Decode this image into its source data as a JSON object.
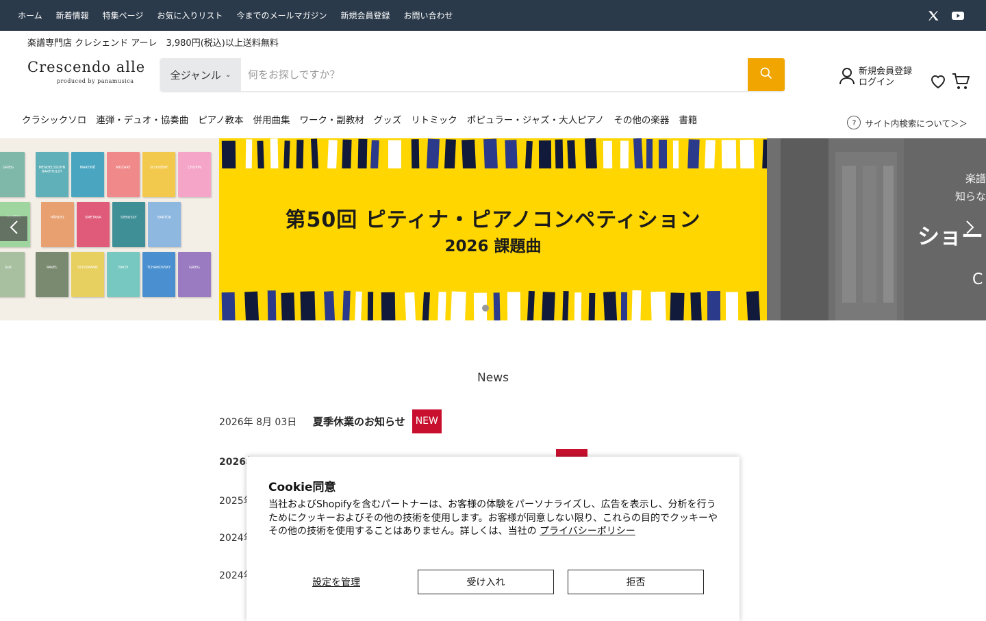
{
  "topbar": {
    "links": [
      "ホーム",
      "新着情報",
      "特集ページ",
      "お気に入りリスト",
      "今までのメールマガジン",
      "新規会員登録",
      "お問い合わせ"
    ],
    "social": [
      "x-icon",
      "youtube-icon"
    ]
  },
  "promo": "楽譜専門店 クレシェンド アーレ　3,980円(税込)以上送料無料",
  "logo": {
    "main": "Crescendo alle",
    "sub": "produced by panamusica"
  },
  "search": {
    "genre": "全ジャンル",
    "placeholder": "何をお探しですか？"
  },
  "account": {
    "register": "新規会員登録",
    "login": "ログイン"
  },
  "categories": [
    "クラシックソロ",
    "連弾・デュオ・協奏曲",
    "ピアノ教本",
    "併用曲集",
    "ワーク・副教材",
    "グッズ",
    "リトミック",
    "ポピュラー・ジャズ・大人ピアノ",
    "その他の楽器",
    "書籍"
  ],
  "site_help": "サイト内検索について＞＞",
  "carousel": {
    "left_books": [
      "GRIEG",
      "MENDELSSOHN BARTHOLDY",
      "MARTINŮ",
      "MOZART",
      "SCHUBERT",
      "CHOPIN",
      "DVOŘÁK",
      "HÄNDEL",
      "SMETANA",
      "DEBUSSY",
      "BARTÓK",
      "SUK",
      "RAVEL",
      "SCHUMANN",
      "BACH",
      "TCHAIKOVSKY"
    ],
    "main_title": "第50回 ピティナ・ピアノコンペティション",
    "main_subtitle": "2026 課題曲",
    "right_line1": "楽譜",
    "right_line2": "知らな",
    "right_title": "ショー",
    "right_letter": "C",
    "colors": {
      "main_bg": "#ffd600",
      "accent": "#f0a500"
    }
  },
  "news": {
    "heading": "News",
    "items": [
      {
        "date": "2026年 8月 03日",
        "title": "夏季休業のお知らせ",
        "badge": "NEW"
      },
      {
        "date": "2026年",
        "title": "",
        "badge": ""
      },
      {
        "date": "2025年",
        "title": "",
        "badge": ""
      },
      {
        "date": "2024年",
        "title": "",
        "badge": ""
      },
      {
        "date": "2024年",
        "title": "",
        "badge": ""
      }
    ]
  },
  "cookie": {
    "title": "Cookie同意",
    "body": "当社およびShopifyを含むパートナーは、お客様の体験をパーソナライズし、広告を表示し、分析を行うためにクッキーおよびその他の技術を使用します。お客様が同意しない限り、これらの目的でクッキーやその他の技術を使用することはありません。詳しくは、当社の ",
    "policy_link": "プライバシーポリシー",
    "manage": "設定を管理",
    "accept": "受け入れ",
    "reject": "拒否"
  }
}
